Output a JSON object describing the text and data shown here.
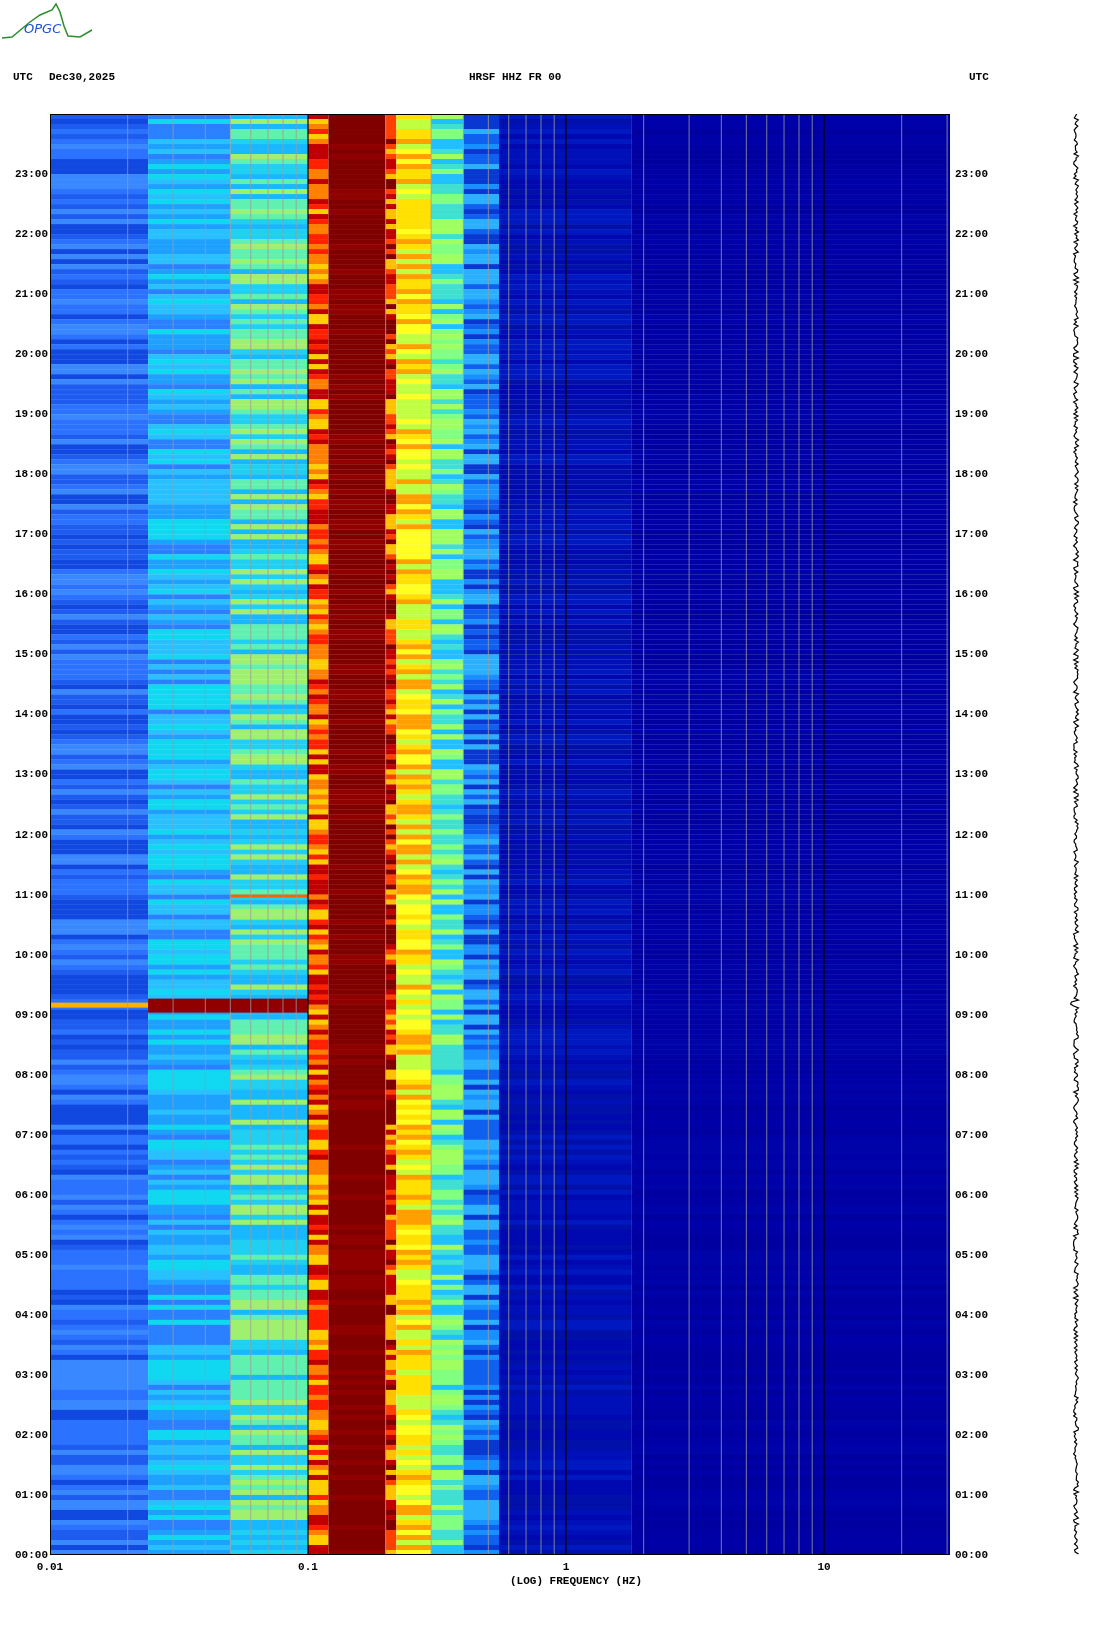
{
  "logo": {
    "text": "OPGC"
  },
  "header": {
    "timezone_left": "UTC",
    "date": "Dec30,2025",
    "station": "HRSF HHZ FR 00",
    "timezone_right": "UTC"
  },
  "spectrogram": {
    "hours_left": [
      "23:00",
      "22:00",
      "21:00",
      "20:00",
      "19:00",
      "18:00",
      "17:00",
      "16:00",
      "15:00",
      "14:00",
      "13:00",
      "12:00",
      "11:00",
      "10:00",
      "09:00",
      "08:00",
      "07:00",
      "06:00",
      "05:00",
      "04:00",
      "03:00",
      "02:00",
      "01:00",
      "00:00"
    ],
    "hours_right": [
      "23:00",
      "22:00",
      "21:00",
      "20:00",
      "19:00",
      "18:00",
      "17:00",
      "16:00",
      "15:00",
      "14:00",
      "13:00",
      "12:00",
      "11:00",
      "10:00",
      "09:00",
      "08:00",
      "07:00",
      "06:00",
      "05:00",
      "04:00",
      "03:00",
      "02:00",
      "01:00",
      "00:00"
    ],
    "frequency_ticks": [
      "0.01",
      "0.1",
      "1",
      "10"
    ],
    "xlabel": "(LOG) FREQUENCY (HZ)"
  }
}
